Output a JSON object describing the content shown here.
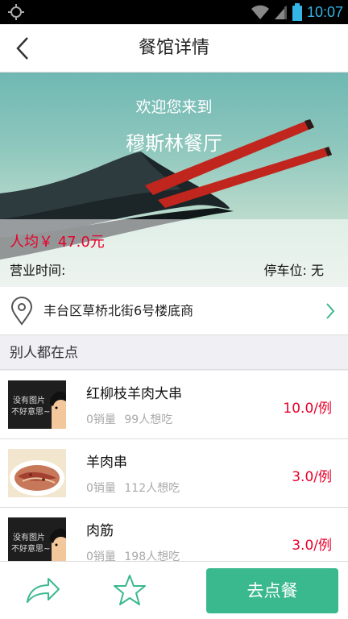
{
  "status_bar": {
    "time": "10:07",
    "icons": [
      "gps-icon",
      "wifi-icon",
      "signal-icon",
      "battery-icon"
    ]
  },
  "header": {
    "title": "餐馆详情",
    "back_icon": "chevron-left-icon"
  },
  "hero": {
    "welcome": "欢迎您来到",
    "restaurant_name": "穆斯林餐厅",
    "avg_price": "人均￥ 47.0元",
    "hours_label": "营业时间:",
    "parking": "停车位: 无"
  },
  "address": {
    "text": "丰台区草桥北街6号楼底商",
    "icon": "location-pin-icon"
  },
  "section": {
    "title": "别人都在点"
  },
  "dishes": [
    {
      "name": "红柳枝羊肉大串",
      "sales": "0销量",
      "wants": "99人想吃",
      "price": "10.0/例",
      "thumb": "no-image-placeholder"
    },
    {
      "name": "羊肉串",
      "sales": "0销量",
      "wants": "112人想吃",
      "price": "3.0/例",
      "thumb": "lamb-skewer-photo"
    },
    {
      "name": "肉筋",
      "sales": "0销量",
      "wants": "198人想吃",
      "price": "3.0/例",
      "thumb": "no-image-placeholder"
    }
  ],
  "placeholder_text": {
    "line1": "没有图片",
    "line2": "不好意思~"
  },
  "bottom_bar": {
    "order_label": "去点餐",
    "share_icon": "share-icon",
    "favorite_icon": "star-icon"
  },
  "colors": {
    "accent": "#3ab88e",
    "price_red": "#e8002b",
    "status_blue": "#33b5e5"
  }
}
